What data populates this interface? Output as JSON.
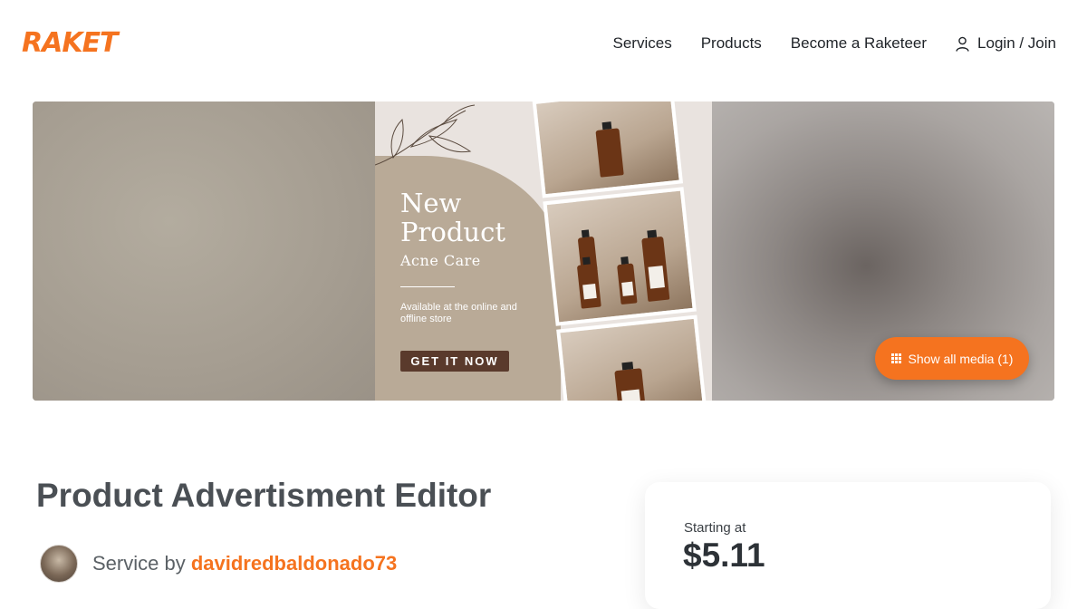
{
  "header": {
    "logo": "RAKET",
    "nav": [
      {
        "label": "Services"
      },
      {
        "label": "Products"
      },
      {
        "label": "Become a Raketeer"
      }
    ],
    "login_label": "Login / Join"
  },
  "hero": {
    "poster": {
      "title": "New Product",
      "subtitle": "Acne Care",
      "note": "Available at the online and offline store",
      "cta": "GET IT NOW"
    },
    "media_button": "Show all media (1)"
  },
  "service": {
    "title": "Product Advertisment Editor",
    "byline_prefix": "Service by",
    "seller": "davidredbaldonado73"
  },
  "pricing": {
    "label": "Starting at",
    "price": "$5.11"
  },
  "colors": {
    "brand": "#f5731f",
    "cta_brown": "#5a3a2c"
  }
}
